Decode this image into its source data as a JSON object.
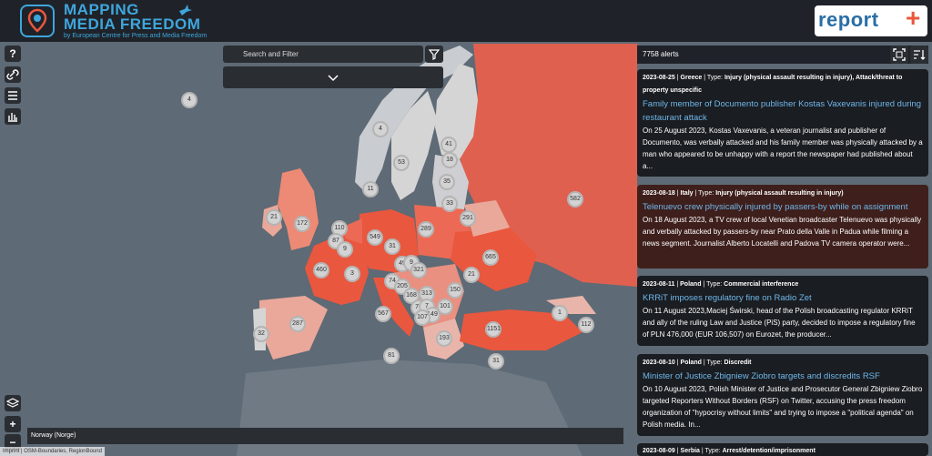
{
  "app": {
    "title_line1": "MAPPING",
    "title_line2": "MEDIA FREEDOM",
    "subtitle": "by European Centre for Press and Media Freedom",
    "partner_logo": "report",
    "partner_logo_small": ""
  },
  "search": {
    "placeholder": "Search and Filter"
  },
  "left_controls": [
    {
      "name": "help-button",
      "label": "?"
    },
    {
      "name": "link-button",
      "label": "🔗"
    },
    {
      "name": "list-button",
      "label": "☰"
    },
    {
      "name": "stats-button",
      "label": "▮▮"
    }
  ],
  "zoom": {
    "plus": "+",
    "minus": "−"
  },
  "clusters": [
    "4",
    "4",
    "41",
    "53",
    "18",
    "11",
    "35",
    "33",
    "21",
    "172",
    "289",
    "291",
    "582",
    "110",
    "87",
    "9",
    "549",
    "31",
    "665",
    "460",
    "3",
    "49",
    "9",
    "321",
    "21",
    "74",
    "205",
    "168",
    "313",
    "150",
    "287",
    "567",
    "78",
    "7",
    "101",
    "149",
    "107",
    "1",
    "112",
    "32",
    "1151",
    "193",
    "81",
    "31"
  ],
  "panel": {
    "count": "7758 alerts"
  },
  "alerts": [
    {
      "date": "2023-08-25",
      "country": "Greece",
      "type_label": "Type:",
      "type": "Injury (physical assault resulting in injury), Attack/threat to property unspecific",
      "title": "Family member of Documento publisher Kostas Vaxevanis injured during restaurant attack",
      "text": "On 25 August 2023, Kostas Vaxevanis, a veteran journalist and publisher of Documento, was verbally attacked and his family member was physically attacked by a man who appeared to be unhappy with a report the newspaper had published about a..."
    },
    {
      "date": "2023-08-18",
      "country": "Italy",
      "type_label": "Type:",
      "type": "Injury (physical assault resulting in injury)",
      "title": "Telenuevo crew physically injured by passers-by while on assignment",
      "text": "On 18 August 2023, a TV crew of local Venetian broadcaster Telenuevo was physically and verbally attacked by passers-by near Prato della Valle in Padua while filming a news segment. Journalist Alberto Locatelli and Padova TV camera operator were..."
    },
    {
      "date": "2023-08-11",
      "country": "Poland",
      "type_label": "Type:",
      "type": "Commercial interference",
      "title": "KRRiT imposes regulatory fine on Radio Zet",
      "text": "On 11 August 2023,Maciej Świrski, head of the Polish broadcasting regulator KRRiT and ally of the ruling Law and Justice (PiS) party, decided to impose a regulatory fine of PLN 476,000 (EUR 106,507) on Eurozet, the producer..."
    },
    {
      "date": "2023-08-10",
      "country": "Poland",
      "type_label": "Type:",
      "type": "Discredit",
      "title": "Minister of Justice Zbigniew Ziobro targets and discredits RSF",
      "text": "On 10 August 2023, Polish Minister of Justice and Prosecutor General Zbigniew Ziobro targeted Reporters Without Borders (RSF) on Twitter, accusing the press freedom organization of \"hypocrisy without limits\" and trying to impose a \"political agenda\" on Polish media. In..."
    },
    {
      "date": "2023-08-09",
      "country": "Serbia",
      "type_label": "Type:",
      "type": "Arrest/detention/imprisonment",
      "title": "",
      "text": ""
    }
  ],
  "map_status": {
    "hover_country": "Norway (Norge)"
  },
  "attribution": "Imprint | OSM-Boundaries, RegionBound",
  "colors": {
    "header": "#1f2329",
    "accent": "#3fa6dc",
    "sea": "#5e6a75",
    "high": "#e9573e",
    "low": "#d3d3d3"
  }
}
